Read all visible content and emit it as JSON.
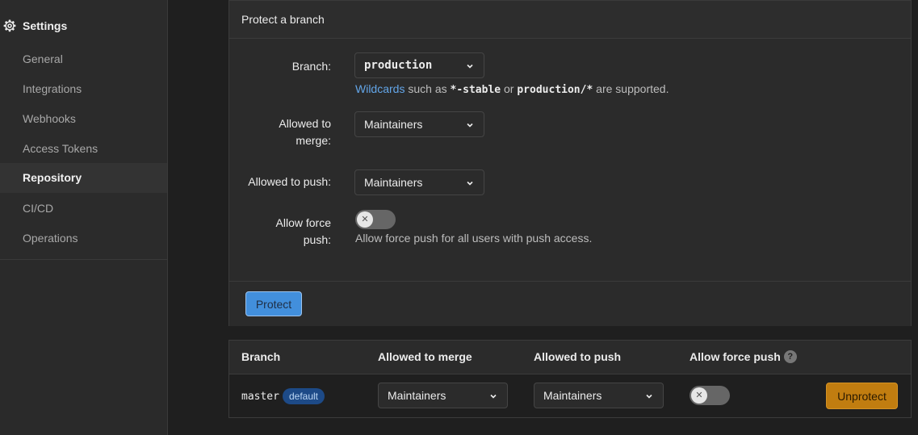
{
  "sidebar": {
    "header": "Settings",
    "items": [
      {
        "label": "General",
        "active": false
      },
      {
        "label": "Integrations",
        "active": false
      },
      {
        "label": "Webhooks",
        "active": false
      },
      {
        "label": "Access Tokens",
        "active": false
      },
      {
        "label": "Repository",
        "active": true
      },
      {
        "label": "CI/CD",
        "active": false
      },
      {
        "label": "Operations",
        "active": false
      }
    ]
  },
  "protect_form": {
    "title": "Protect a branch",
    "branch_label": "Branch:",
    "branch_value": "production",
    "wildcards_link": "Wildcards",
    "help_such_as": "such as",
    "help_example1": "*-stable",
    "help_or": "or",
    "help_example2": "production/*",
    "help_supported": "are supported.",
    "merge_label_line1": "Allowed to",
    "merge_label_line2": "merge:",
    "merge_value": "Maintainers",
    "push_label": "Allowed to push:",
    "push_value": "Maintainers",
    "force_label_line1": "Allow force",
    "force_label_line2": "push:",
    "force_toggle_on": false,
    "force_help": "Allow force push for all users with push access.",
    "protect_button": "Protect"
  },
  "protected_table": {
    "headers": {
      "branch": "Branch",
      "merge": "Allowed to merge",
      "push": "Allowed to push",
      "force": "Allow force push"
    },
    "rows": [
      {
        "branch": "master",
        "badge": "default",
        "merge": "Maintainers",
        "push": "Maintainers",
        "force_on": false,
        "action": "Unprotect"
      }
    ]
  },
  "colors": {
    "accent_blue": "#428fdc",
    "link_blue": "#63a6e9",
    "warning_orange": "#c17d10",
    "badge_blue": "#1d4a87"
  }
}
